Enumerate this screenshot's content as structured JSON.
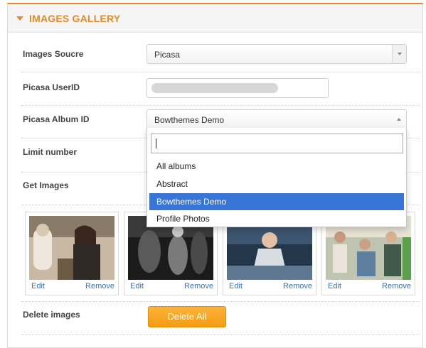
{
  "header": {
    "title": "IMAGES GALLERY"
  },
  "fields": {
    "source_label": "Images Soucre",
    "source_value": "Picasa",
    "userid_label": "Picasa UserID",
    "album_label": "Picasa Album ID",
    "album_value": "Bowthemes Demo",
    "limit_label": "Limit number",
    "get_images_label": "Get Images",
    "delete_label": "Delete images"
  },
  "dropdown": {
    "search_value": "",
    "options": [
      "All albums",
      "Abstract",
      "Bowthemes Demo",
      "Profile Photos"
    ],
    "selected": "Bowthemes Demo"
  },
  "thumbnails": [
    {
      "edit": "Edit",
      "remove": "Remove"
    },
    {
      "edit": "Edit",
      "remove": "Remove"
    },
    {
      "edit": "Edit",
      "remove": "Remove"
    },
    {
      "edit": "Edit",
      "remove": "Remove"
    }
  ],
  "buttons": {
    "delete_all": "Delete All"
  },
  "colors": {
    "accent": "#e48a2a",
    "selected": "#3875d7",
    "link": "#3b73b9",
    "button": "#f39c12"
  }
}
